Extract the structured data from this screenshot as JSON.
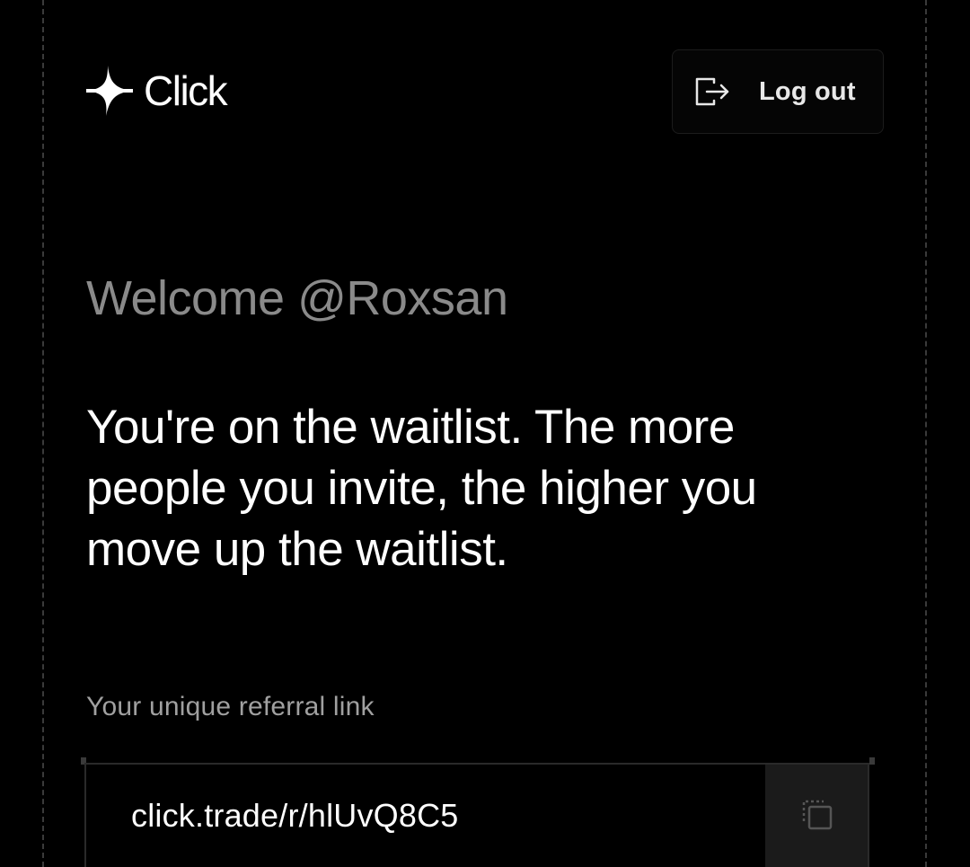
{
  "brand": {
    "logo_icon": "sparkle-cross-icon",
    "name": "Click"
  },
  "header": {
    "logout_label": "Log out",
    "logout_icon": "logout-icon"
  },
  "main": {
    "welcome": "Welcome @Roxsan",
    "message": "You're on the waitlist. The more people you invite, the higher you move up the waitlist."
  },
  "referral": {
    "label": "Your unique referral link",
    "link": "click.trade/r/hlUvQ8C5",
    "copy_icon": "copy-icon"
  },
  "colors": {
    "background": "#000000",
    "text_primary": "#ffffff",
    "text_muted": "#8a8a8a",
    "copy_button_bg": "#1b1b1b"
  }
}
